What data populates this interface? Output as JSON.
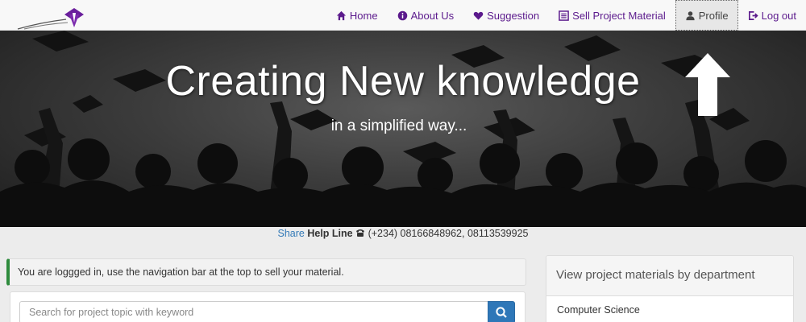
{
  "nav": {
    "items": [
      {
        "label": "Home",
        "icon": "home-icon"
      },
      {
        "label": "About Us",
        "icon": "info-icon"
      },
      {
        "label": "Suggestion",
        "icon": "heart-icon"
      },
      {
        "label": "Sell Project Material",
        "icon": "list-icon"
      },
      {
        "label": "Profile",
        "icon": "user-icon",
        "active": true
      },
      {
        "label": "Log out",
        "icon": "logout-icon"
      }
    ]
  },
  "hero": {
    "title": "Creating New knowledge",
    "subtitle": "in a simplified way..."
  },
  "helpline": {
    "share": "Share",
    "label": "Help Line",
    "icon": "phone-icon",
    "numbers": "(+234) 08166848962, 08113539925"
  },
  "alert": {
    "message": "You are loggged in, use the navigation bar at the top to sell your material."
  },
  "search": {
    "placeholder": "Search for project topic with keyword",
    "button_icon": "search-icon"
  },
  "departments": {
    "title": "View project materials by department",
    "items": [
      "Computer Science"
    ]
  },
  "colors": {
    "brand": "#5b1a8c",
    "alert_border": "#2e8b3d",
    "search_button": "#2e77b8"
  }
}
